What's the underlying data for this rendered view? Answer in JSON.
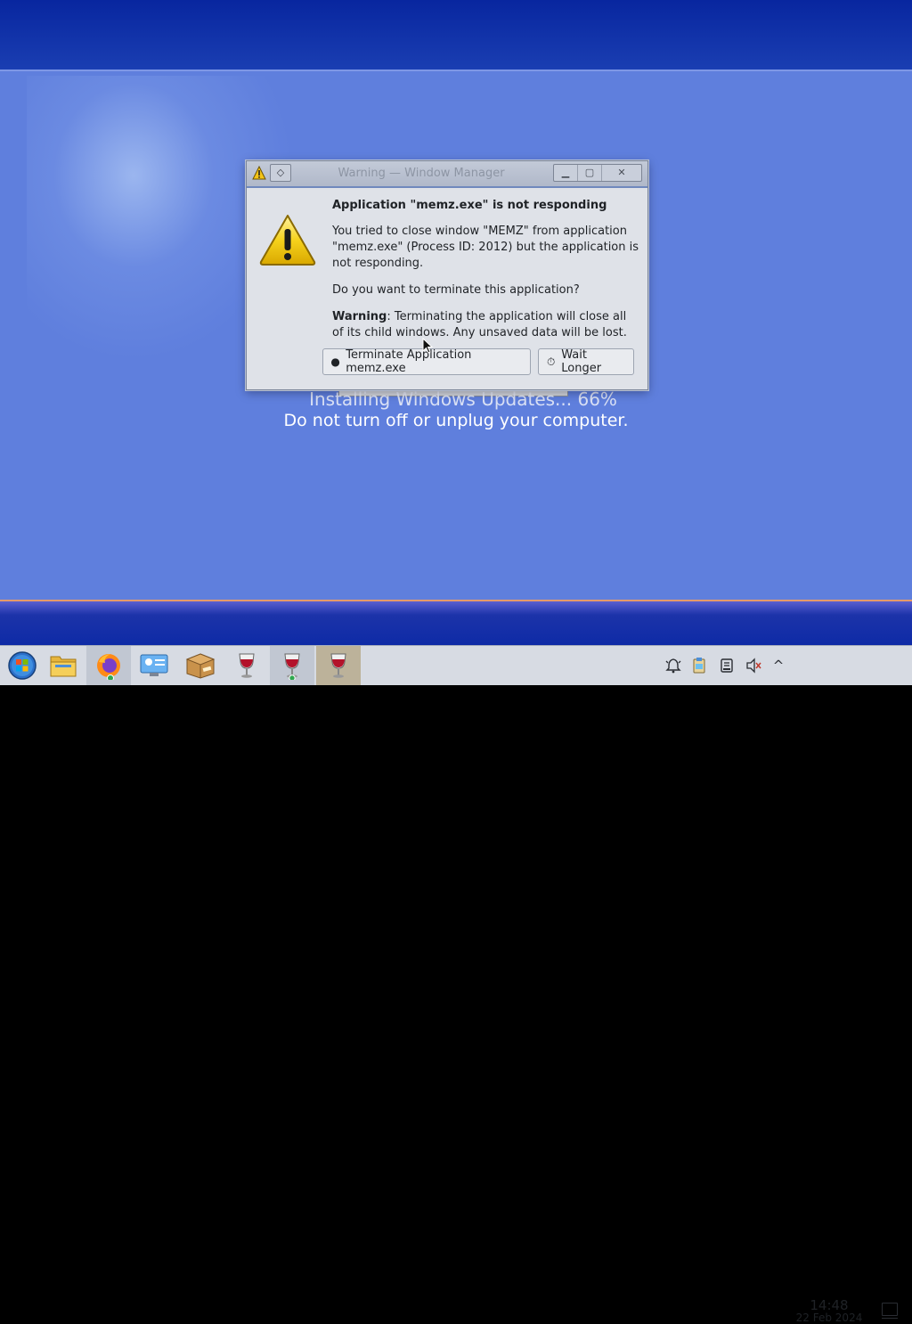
{
  "dialog": {
    "title": "Warning — Window Manager",
    "pin_glyph": "◇",
    "minimize_glyph": "▁",
    "maximize_glyph": "▢",
    "close_glyph": "✕",
    "heading": "Application \"memz.exe\" is not responding",
    "body1": "You tried to close window \"MEMZ\" from application \"memz.exe\" (Process ID: 2012) but the application is not responding.",
    "body2": "Do you want to terminate this application?",
    "warning_label": "Warning",
    "warning_text": ": Terminating the application will close all of its child windows. Any unsaved data will be lost.",
    "terminate_label": "Terminate Application memz.exe",
    "terminate_icon": "●",
    "wait_label": "Wait Longer",
    "wait_icon": "⏱"
  },
  "background": {
    "line1": "Installing Windows Updates... 66%",
    "line2": "Do not turn off or unplug your computer."
  },
  "taskbar": {
    "items": [
      {
        "icon": "start-orb-icon"
      },
      {
        "icon": "file-manager-icon"
      },
      {
        "icon": "firefox-icon"
      },
      {
        "icon": "system-settings-icon"
      },
      {
        "icon": "package-box-icon"
      },
      {
        "icon": "wine-glass-icon"
      },
      {
        "icon": "wine-glass-icon"
      },
      {
        "icon": "wine-glass-icon"
      }
    ],
    "tray": [
      "notifications-icon",
      "clipboard-icon",
      "storage-icon",
      "mute-icon",
      "expand-arrow-icon"
    ],
    "expand_glyph": "^",
    "time": "14:48",
    "date": "22 Feb 2024"
  },
  "colors": {
    "desktop": "#5f7fdd",
    "top_band": "#08269f",
    "taskbar": "#d7dbe3",
    "dialog_bg": "#dfe2e8"
  }
}
